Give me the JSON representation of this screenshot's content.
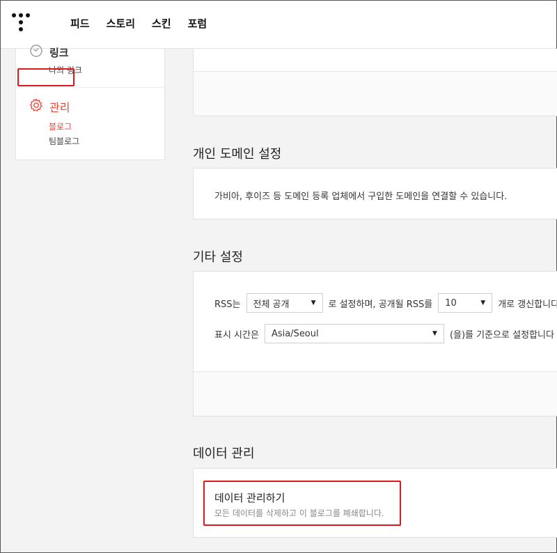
{
  "header": {
    "nav": [
      "피드",
      "스토리",
      "스킨",
      "포럼"
    ]
  },
  "sidebar": {
    "link_group": {
      "label": "링크",
      "sub": "나의 링크"
    },
    "manage_group": {
      "label": "관리",
      "items": [
        "블로그",
        "팀블로그"
      ]
    }
  },
  "domain": {
    "title": "개인 도메인 설정",
    "description": "가비아, 후이즈 등 도메인 등록 업체에서 구입한 도메인을 연결할 수 있습니다."
  },
  "etc": {
    "title": "기타 설정",
    "rss_prefix": "RSS는",
    "rss_select": "전체 공개",
    "rss_middle": "로 설정하며, 공개될 RSS를",
    "rss_count": "10",
    "rss_suffix": "개로 갱신합니다",
    "time_prefix": "표시 시간은",
    "timezone": "Asia/Seoul",
    "time_suffix": "(을)를 기준으로 설정합니다"
  },
  "data_manage": {
    "title": "데이터 관리",
    "action_title": "데이터 관리하기",
    "action_desc": "모든 데이터를 삭제하고 이 블로그를 폐쇄합니다."
  },
  "colors": {
    "accent": "#e8473b",
    "highlight": "#e0161b"
  }
}
